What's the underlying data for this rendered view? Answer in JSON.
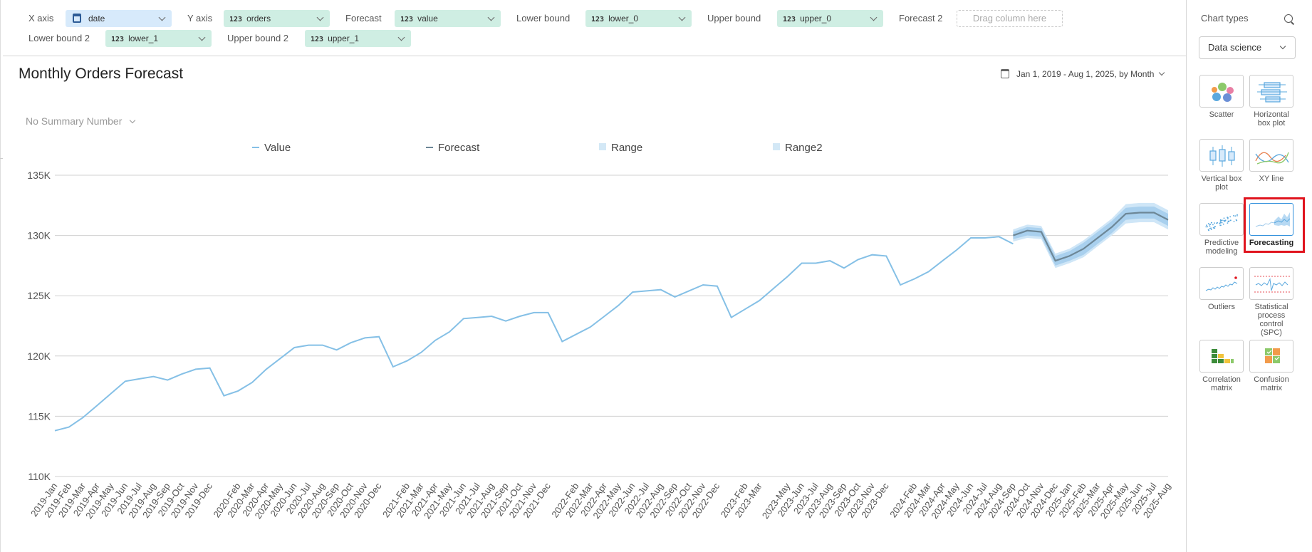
{
  "fields": {
    "x_axis": {
      "label": "X axis",
      "value": "date"
    },
    "y_axis": {
      "label": "Y axis",
      "value": "orders",
      "type_glyph": "123"
    },
    "forecast": {
      "label": "Forecast",
      "value": "value",
      "type_glyph": "123"
    },
    "lower_bound": {
      "label": "Lower bound",
      "value": "lower_0",
      "type_glyph": "123"
    },
    "upper_bound": {
      "label": "Upper bound",
      "value": "upper_0",
      "type_glyph": "123"
    },
    "forecast_2": {
      "label": "Forecast 2",
      "placeholder": "Drag column here"
    },
    "lower_bound_2": {
      "label": "Lower bound 2",
      "value": "lower_1",
      "type_glyph": "123"
    },
    "upper_bound_2": {
      "label": "Upper bound 2",
      "value": "upper_1",
      "type_glyph": "123"
    }
  },
  "chart_header": {
    "title": "Monthly Orders Forecast",
    "date_range": "Jan 1, 2019 - Aug 1, 2025, by Month",
    "summary": "No Summary Number"
  },
  "legend": [
    {
      "label": "Value",
      "kind": "line",
      "color": "#85c0e6"
    },
    {
      "label": "Forecast",
      "kind": "line",
      "color": "#6d8797"
    },
    {
      "label": "Range",
      "kind": "box",
      "color": "#d3e8f6"
    },
    {
      "label": "Range2",
      "kind": "box",
      "color": "#d3e8f6"
    }
  ],
  "chart_data": {
    "type": "line",
    "ylim": [
      110000,
      135000
    ],
    "yticks": [
      "110K",
      "115K",
      "120K",
      "125K",
      "130K",
      "135K"
    ],
    "ytick_values": [
      110000,
      115000,
      120000,
      125000,
      130000,
      135000
    ],
    "grid": true,
    "legend_position": "top",
    "x": [
      "2019-Jan",
      "2019-Feb",
      "2019-Mar",
      "2019-Apr",
      "2019-May",
      "2019-Jun",
      "2019-Jul",
      "2019-Aug",
      "2019-Sep",
      "2019-Oct",
      "2019-Nov",
      "2019-Dec",
      "2020-Jan",
      "2020-Feb",
      "2020-Mar",
      "2020-Apr",
      "2020-May",
      "2020-Jun",
      "2020-Jul",
      "2020-Aug",
      "2020-Sep",
      "2020-Oct",
      "2020-Nov",
      "2020-Dec",
      "2021-Jan",
      "2021-Feb",
      "2021-Mar",
      "2021-Apr",
      "2021-May",
      "2021-Jun",
      "2021-Jul",
      "2021-Aug",
      "2021-Sep",
      "2021-Oct",
      "2021-Nov",
      "2021-Dec",
      "2022-Jan",
      "2022-Feb",
      "2022-Mar",
      "2022-Apr",
      "2022-May",
      "2022-Jun",
      "2022-Jul",
      "2022-Aug",
      "2022-Sep",
      "2022-Oct",
      "2022-Nov",
      "2022-Dec",
      "2023-Jan",
      "2023-Feb",
      "2023-Mar",
      "2023-Apr",
      "2023-May",
      "2023-Jun",
      "2023-Jul",
      "2023-Aug",
      "2023-Sep",
      "2023-Oct",
      "2023-Nov",
      "2023-Dec",
      "2024-Jan",
      "2024-Feb",
      "2024-Mar",
      "2024-Apr",
      "2024-May",
      "2024-Jun",
      "2024-Jul",
      "2024-Aug",
      "2024-Sep",
      "2024-Oct",
      "2024-Nov",
      "2024-Dec",
      "2025-Jan",
      "2025-Feb",
      "2025-Mar",
      "2025-Apr",
      "2025-May",
      "2025-Jun",
      "2025-Jul",
      "2025-Aug"
    ],
    "x_visible_labels": [
      "2019-Jan",
      "2019-Feb",
      "2019-Mar",
      "2019-Apr",
      "2019-May",
      "2019-Jun",
      "2019-Jul",
      "2019-Aug",
      "2019-Sep",
      "2019-Oct",
      "2019-Nov",
      "2019-Dec",
      "2020-Feb",
      "2020-Mar",
      "2020-Apr",
      "2020-May",
      "2020-Jun",
      "2020-Jul",
      "2020-Aug",
      "2020-Sep",
      "2020-Oct",
      "2020-Nov",
      "2020-Dec",
      "2021-Feb",
      "2021-Mar",
      "2021-Apr",
      "2021-May",
      "2021-Jun",
      "2021-Jul",
      "2021-Aug",
      "2021-Sep",
      "2021-Oct",
      "2021-Nov",
      "2021-Dec",
      "2022-Feb",
      "2022-Mar",
      "2022-Apr",
      "2022-May",
      "2022-Jun",
      "2022-Jul",
      "2022-Aug",
      "2022-Sep",
      "2022-Oct",
      "2022-Nov",
      "2022-Dec",
      "2023-Feb",
      "2023-Mar",
      "2023-May",
      "2023-Jun",
      "2023-Jul",
      "2023-Aug",
      "2023-Sep",
      "2023-Oct",
      "2023-Nov",
      "2023-Dec",
      "2024-Feb",
      "2024-Mar",
      "2024-Apr",
      "2024-May",
      "2024-Jun",
      "2024-Jul",
      "2024-Aug",
      "2024-Sep",
      "2024-Oct",
      "2024-Nov",
      "2024-Dec",
      "2025-Jan",
      "2025-Feb",
      "2025-Mar",
      "2025-Apr",
      "2025-May",
      "2025-Jun",
      "2025-Jul",
      "2025-Aug"
    ],
    "series": [
      {
        "name": "Value",
        "color": "#85c0e6",
        "start_index": 0,
        "values": [
          113800,
          114100,
          114900,
          115900,
          116900,
          117900,
          118100,
          118300,
          118000,
          118500,
          118900,
          119000,
          116700,
          117100,
          117800,
          118900,
          119800,
          120700,
          120900,
          120900,
          120500,
          121100,
          121500,
          121600,
          119100,
          119600,
          120300,
          121300,
          122000,
          123100,
          123200,
          123300,
          122900,
          123300,
          123600,
          123600,
          121200,
          121800,
          122400,
          123300,
          124200,
          125300,
          125400,
          125500,
          124900,
          125400,
          125900,
          125800,
          123200,
          123900,
          124600,
          125600,
          126600,
          127700,
          127700,
          127900,
          127300,
          128000,
          128400,
          128300,
          125900,
          126400,
          127000,
          127900,
          128800,
          129800,
          129800,
          129900,
          129300
        ]
      },
      {
        "name": "Forecast",
        "color": "#6d8797",
        "start_index": 68,
        "values": [
          130000,
          130400,
          130300,
          127900,
          128300,
          128900,
          129800,
          130700,
          131800,
          131900,
          131900,
          131300
        ],
        "lower": [
          129700,
          130000,
          129900,
          127500,
          127900,
          128400,
          129300,
          130200,
          131300,
          131400,
          131400,
          130800
        ],
        "upper": [
          130300,
          130700,
          130600,
          128300,
          128700,
          129400,
          130300,
          131200,
          132300,
          132400,
          132400,
          131800
        ],
        "lower2": [
          129500,
          129800,
          129700,
          127300,
          127700,
          128200,
          129100,
          130000,
          131000,
          131100,
          131100,
          130500
        ],
        "upper2": [
          130500,
          130900,
          130800,
          128500,
          128900,
          129600,
          130500,
          131400,
          132600,
          132700,
          132700,
          132100
        ]
      }
    ]
  },
  "sidebar": {
    "title": "Chart types",
    "category": "Data science",
    "tiles": [
      {
        "label": "Scatter",
        "icon": "scatter-icon"
      },
      {
        "label": "Horizontal box plot",
        "icon": "horizontal-box-plot-icon"
      },
      {
        "label": "Vertical box plot",
        "icon": "vertical-box-plot-icon"
      },
      {
        "label": "XY line",
        "icon": "xy-line-icon"
      },
      {
        "label": "Predictive modeling",
        "icon": "predictive-modeling-icon"
      },
      {
        "label": "Forecasting",
        "icon": "forecasting-icon",
        "selected": true
      },
      {
        "label": "Outliers",
        "icon": "outliers-icon"
      },
      {
        "label": "Statistical process control (SPC)",
        "icon": "spc-icon"
      },
      {
        "label": "Correlation matrix",
        "icon": "correlation-matrix-icon"
      },
      {
        "label": "Confusion matrix",
        "icon": "confusion-matrix-icon"
      }
    ]
  }
}
